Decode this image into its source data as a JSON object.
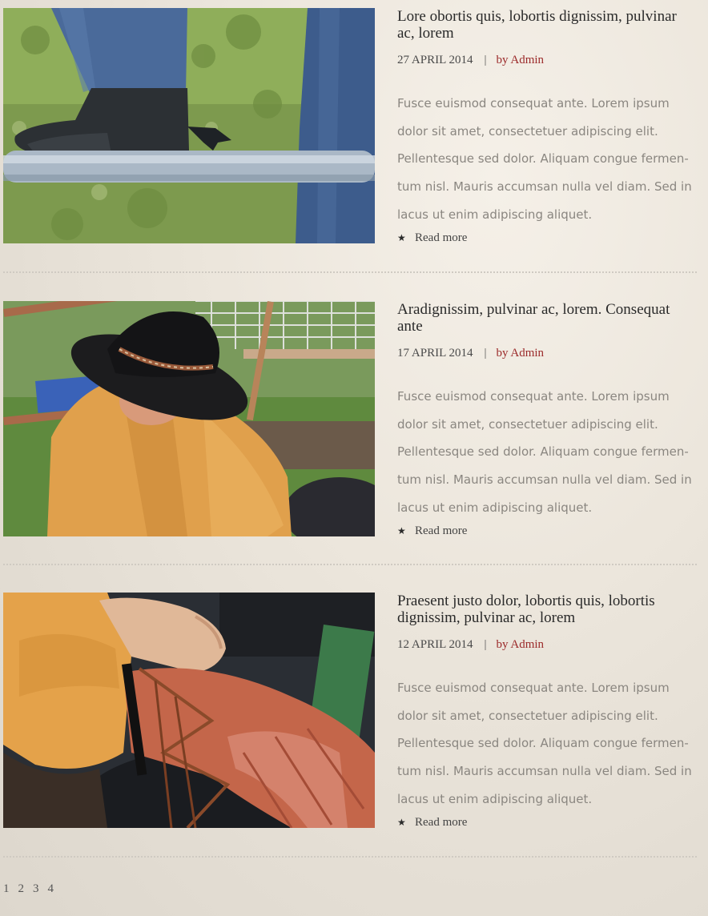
{
  "posts": [
    {
      "title": "Lore obortis quis, lobortis dignissim, pulvinar ac, lorem",
      "date": "27 APRIL 2014",
      "author": "by Admin",
      "excerpt": "Fusce euismod consequat ante. Lorem ipsum dolor sit amet, consectetuer adipiscing elit. Pellentesque sed dolor. Aliquam congue fermen-tum nisl. Mauris accumsan nulla vel diam. Sed in lacus ut enim adipiscing aliquet.",
      "read_more": "Read more"
    },
    {
      "title": "Aradignissim, pulvinar ac, lorem. Consequat ante",
      "date": "17 APRIL 2014",
      "author": "by Admin",
      "excerpt": "Fusce euismod consequat ante. Lorem ipsum dolor sit amet, consectetuer adipiscing elit. Pellentesque sed dolor. Aliquam congue fermen-tum nisl. Mauris accumsan nulla vel diam. Sed in lacus ut enim adipiscing aliquet.",
      "read_more": "Read more"
    },
    {
      "title": "Praesent justo dolor, lobortis quis, lobortis dignissim, pulvinar ac, lorem",
      "date": "12 APRIL 2014",
      "author": "by Admin",
      "excerpt": "Fusce euismod consequat ante. Lorem ipsum dolor sit amet, consectetuer adipiscing elit. Pellentesque sed dolor. Aliquam congue fermen-tum nisl. Mauris accumsan nulla vel diam. Sed in lacus ut enim adipiscing aliquet.",
      "read_more": "Read more"
    }
  ],
  "separator": "|",
  "read_more_icon": "star-icon",
  "pagination": [
    "1",
    "2",
    "3",
    "4"
  ],
  "colors": {
    "author": "#9b2a2a",
    "excerpt": "#8a8680",
    "title": "#2a2a2a"
  }
}
